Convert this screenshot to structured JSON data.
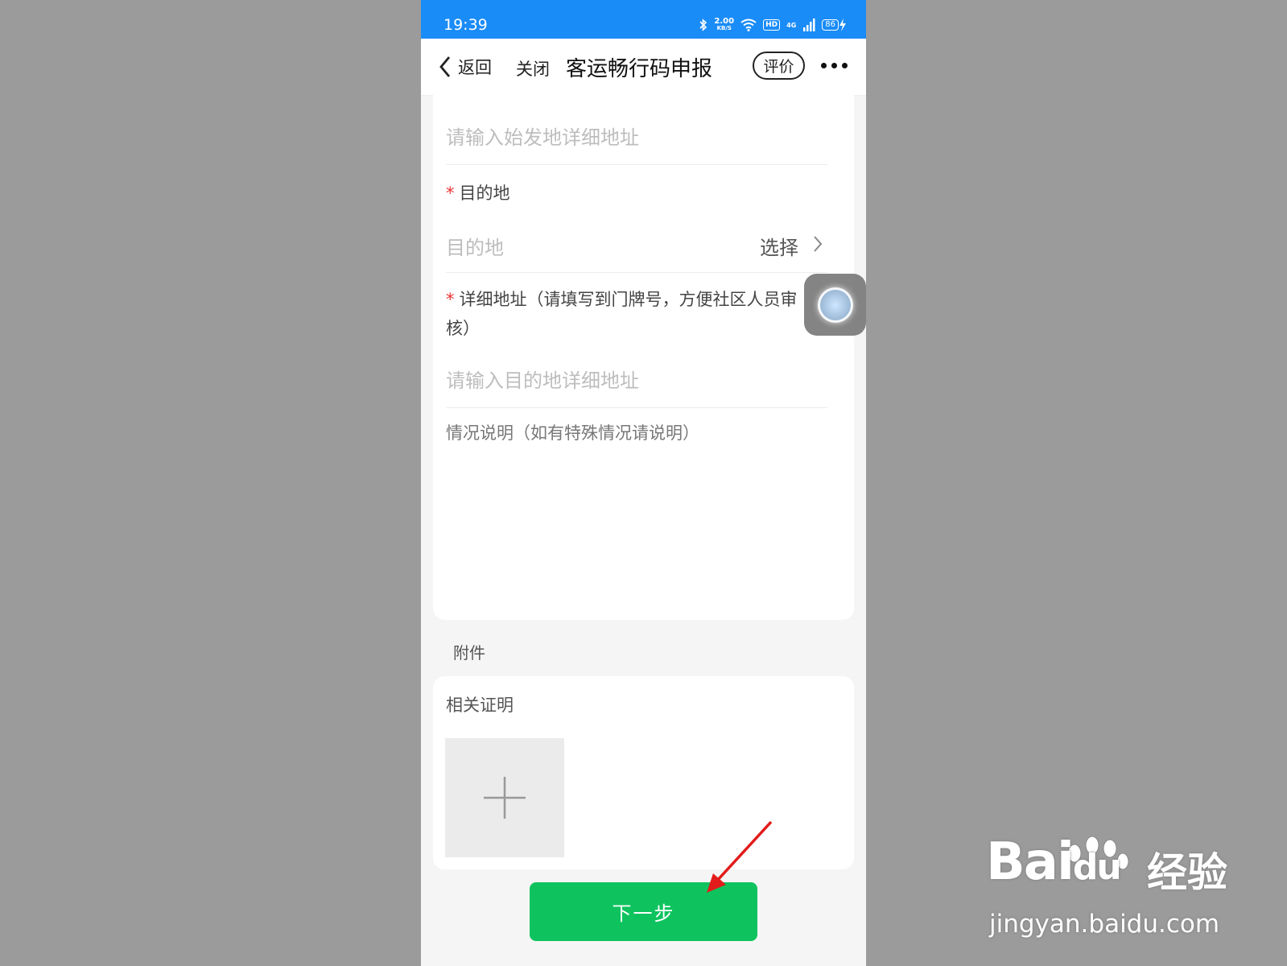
{
  "status_bar": {
    "time": "19:39",
    "speed_value": "2.00",
    "speed_unit": "KB/S",
    "hd_label": "HD",
    "network_label": "4G",
    "battery_level": "86"
  },
  "nav": {
    "back_label": "返回",
    "close_label": "关闭",
    "title": "客运畅行码申报",
    "rate_label": "评价"
  },
  "form": {
    "origin_detail_placeholder": "请输入始发地详细地址",
    "destination_label": "目的地",
    "destination_placeholder": "目的地",
    "destination_select_label": "选择",
    "dest_detail_label_line1": "详细地址（请填写到门牌号，方便社区人员审",
    "dest_detail_label_line2": "核）",
    "dest_detail_placeholder": "请输入目的地详细地址",
    "remarks_placeholder": "情况说明（如有特殊情况请说明）",
    "required_mark": "*"
  },
  "attachments": {
    "section_title": "附件",
    "proof_label": "相关证明"
  },
  "actions": {
    "next_label": "下一步"
  },
  "watermark": {
    "logo": "Bai",
    "logo_suffix": "du",
    "name": "经验",
    "url": "jingyan.baidu.com"
  },
  "colors": {
    "status_bar": "#1a8cf7",
    "primary_button": "#0ec35e",
    "required": "#e33333",
    "annotation_arrow": "#e21b1b"
  }
}
